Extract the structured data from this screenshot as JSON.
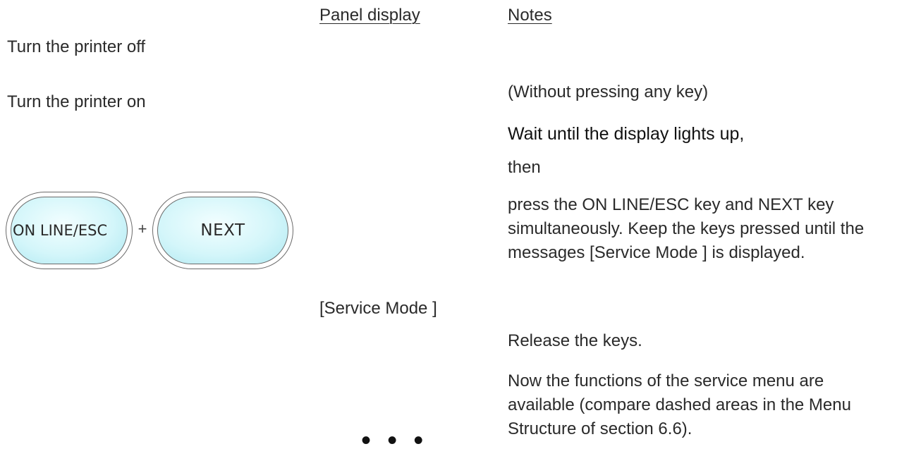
{
  "headers": {
    "panel_display": "Panel display",
    "notes": "Notes"
  },
  "steps": {
    "turn_off": "Turn the printer off",
    "turn_on": "Turn the printer on"
  },
  "keys": {
    "online_esc": "ON LINE/ESC",
    "plus": "+",
    "next": "NEXT"
  },
  "panel": {
    "service_mode": "[Service Mode ]",
    "ellipsis": "• • •"
  },
  "notes": {
    "without_key": "(Without pressing any key)",
    "wait": "Wait until the display lights up",
    "wait_comma": ",",
    "then": "then",
    "press": "press the ON LINE/ESC key and NEXT key simultaneously. Keep the keys pressed until the messages [Service Mode ] is displayed.",
    "release": "Release the keys.",
    "now": "Now the functions of the service menu are available (compare dashed areas in the Menu Structure of section 6.6)."
  },
  "colors": {
    "key_fill": "#d4f6fa",
    "key_border": "#6a6a6a"
  }
}
